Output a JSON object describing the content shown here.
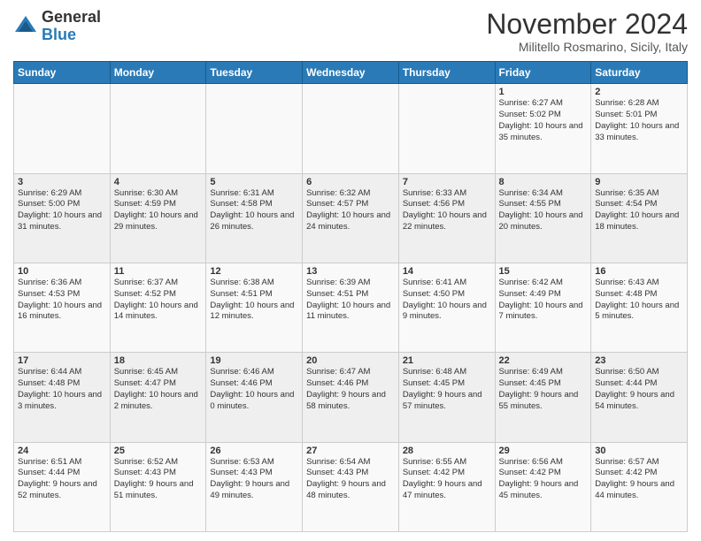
{
  "header": {
    "logo_text_general": "General",
    "logo_text_blue": "Blue",
    "month_title": "November 2024",
    "location": "Militello Rosmarino, Sicily, Italy"
  },
  "days_of_week": [
    "Sunday",
    "Monday",
    "Tuesday",
    "Wednesday",
    "Thursday",
    "Friday",
    "Saturday"
  ],
  "weeks": [
    [
      {
        "day": "",
        "info": ""
      },
      {
        "day": "",
        "info": ""
      },
      {
        "day": "",
        "info": ""
      },
      {
        "day": "",
        "info": ""
      },
      {
        "day": "",
        "info": ""
      },
      {
        "day": "1",
        "info": "Sunrise: 6:27 AM\nSunset: 5:02 PM\nDaylight: 10 hours\nand 35 minutes."
      },
      {
        "day": "2",
        "info": "Sunrise: 6:28 AM\nSunset: 5:01 PM\nDaylight: 10 hours\nand 33 minutes."
      }
    ],
    [
      {
        "day": "3",
        "info": "Sunrise: 6:29 AM\nSunset: 5:00 PM\nDaylight: 10 hours\nand 31 minutes."
      },
      {
        "day": "4",
        "info": "Sunrise: 6:30 AM\nSunset: 4:59 PM\nDaylight: 10 hours\nand 29 minutes."
      },
      {
        "day": "5",
        "info": "Sunrise: 6:31 AM\nSunset: 4:58 PM\nDaylight: 10 hours\nand 26 minutes."
      },
      {
        "day": "6",
        "info": "Sunrise: 6:32 AM\nSunset: 4:57 PM\nDaylight: 10 hours\nand 24 minutes."
      },
      {
        "day": "7",
        "info": "Sunrise: 6:33 AM\nSunset: 4:56 PM\nDaylight: 10 hours\nand 22 minutes."
      },
      {
        "day": "8",
        "info": "Sunrise: 6:34 AM\nSunset: 4:55 PM\nDaylight: 10 hours\nand 20 minutes."
      },
      {
        "day": "9",
        "info": "Sunrise: 6:35 AM\nSunset: 4:54 PM\nDaylight: 10 hours\nand 18 minutes."
      }
    ],
    [
      {
        "day": "10",
        "info": "Sunrise: 6:36 AM\nSunset: 4:53 PM\nDaylight: 10 hours\nand 16 minutes."
      },
      {
        "day": "11",
        "info": "Sunrise: 6:37 AM\nSunset: 4:52 PM\nDaylight: 10 hours\nand 14 minutes."
      },
      {
        "day": "12",
        "info": "Sunrise: 6:38 AM\nSunset: 4:51 PM\nDaylight: 10 hours\nand 12 minutes."
      },
      {
        "day": "13",
        "info": "Sunrise: 6:39 AM\nSunset: 4:51 PM\nDaylight: 10 hours\nand 11 minutes."
      },
      {
        "day": "14",
        "info": "Sunrise: 6:41 AM\nSunset: 4:50 PM\nDaylight: 10 hours\nand 9 minutes."
      },
      {
        "day": "15",
        "info": "Sunrise: 6:42 AM\nSunset: 4:49 PM\nDaylight: 10 hours\nand 7 minutes."
      },
      {
        "day": "16",
        "info": "Sunrise: 6:43 AM\nSunset: 4:48 PM\nDaylight: 10 hours\nand 5 minutes."
      }
    ],
    [
      {
        "day": "17",
        "info": "Sunrise: 6:44 AM\nSunset: 4:48 PM\nDaylight: 10 hours\nand 3 minutes."
      },
      {
        "day": "18",
        "info": "Sunrise: 6:45 AM\nSunset: 4:47 PM\nDaylight: 10 hours\nand 2 minutes."
      },
      {
        "day": "19",
        "info": "Sunrise: 6:46 AM\nSunset: 4:46 PM\nDaylight: 10 hours\nand 0 minutes."
      },
      {
        "day": "20",
        "info": "Sunrise: 6:47 AM\nSunset: 4:46 PM\nDaylight: 9 hours\nand 58 minutes."
      },
      {
        "day": "21",
        "info": "Sunrise: 6:48 AM\nSunset: 4:45 PM\nDaylight: 9 hours\nand 57 minutes."
      },
      {
        "day": "22",
        "info": "Sunrise: 6:49 AM\nSunset: 4:45 PM\nDaylight: 9 hours\nand 55 minutes."
      },
      {
        "day": "23",
        "info": "Sunrise: 6:50 AM\nSunset: 4:44 PM\nDaylight: 9 hours\nand 54 minutes."
      }
    ],
    [
      {
        "day": "24",
        "info": "Sunrise: 6:51 AM\nSunset: 4:44 PM\nDaylight: 9 hours\nand 52 minutes."
      },
      {
        "day": "25",
        "info": "Sunrise: 6:52 AM\nSunset: 4:43 PM\nDaylight: 9 hours\nand 51 minutes."
      },
      {
        "day": "26",
        "info": "Sunrise: 6:53 AM\nSunset: 4:43 PM\nDaylight: 9 hours\nand 49 minutes."
      },
      {
        "day": "27",
        "info": "Sunrise: 6:54 AM\nSunset: 4:43 PM\nDaylight: 9 hours\nand 48 minutes."
      },
      {
        "day": "28",
        "info": "Sunrise: 6:55 AM\nSunset: 4:42 PM\nDaylight: 9 hours\nand 47 minutes."
      },
      {
        "day": "29",
        "info": "Sunrise: 6:56 AM\nSunset: 4:42 PM\nDaylight: 9 hours\nand 45 minutes."
      },
      {
        "day": "30",
        "info": "Sunrise: 6:57 AM\nSunset: 4:42 PM\nDaylight: 9 hours\nand 44 minutes."
      }
    ]
  ]
}
